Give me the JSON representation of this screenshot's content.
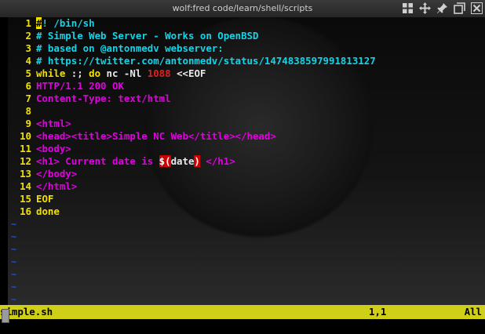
{
  "window": {
    "title": "wolf:fred code/learn/shell/scripts"
  },
  "titlebar_icons": [
    "grid-icon",
    "move-icon",
    "pin-icon",
    "restore-icon",
    "close-icon"
  ],
  "editor": {
    "lines": [
      {
        "num": "1",
        "segments": [
          {
            "t": "#",
            "c": "cursor"
          },
          {
            "t": "! /bin/sh",
            "c": "c-cyan"
          }
        ]
      },
      {
        "num": "2",
        "segments": [
          {
            "t": "# Simple Web Server - Works on OpenBSD",
            "c": "c-cyan"
          }
        ]
      },
      {
        "num": "3",
        "segments": [
          {
            "t": "# based on @antonmedv webserver:",
            "c": "c-cyan"
          }
        ]
      },
      {
        "num": "4",
        "segments": [
          {
            "t": "# https://twitter.com/antonmedv/status/1474838597991813127",
            "c": "c-cyan"
          }
        ]
      },
      {
        "num": "5",
        "segments": [
          {
            "t": "while",
            "c": "c-yellow"
          },
          {
            "t": " :; ",
            "c": "c-white"
          },
          {
            "t": "do",
            "c": "c-yellow"
          },
          {
            "t": " nc -Nl ",
            "c": "c-white"
          },
          {
            "t": "1088",
            "c": "c-red"
          },
          {
            "t": " <<EOF",
            "c": "c-white"
          }
        ]
      },
      {
        "num": "6",
        "segments": [
          {
            "t": "HTTP/1.1 200 OK",
            "c": "c-magenta"
          }
        ]
      },
      {
        "num": "7",
        "segments": [
          {
            "t": "Content-Type: text/html",
            "c": "c-magenta"
          }
        ]
      },
      {
        "num": "8",
        "segments": []
      },
      {
        "num": "9",
        "segments": [
          {
            "t": "<html>",
            "c": "c-magenta"
          }
        ]
      },
      {
        "num": "10",
        "segments": [
          {
            "t": "<head><title>Simple NC Web</title></head>",
            "c": "c-magenta"
          }
        ]
      },
      {
        "num": "11",
        "segments": [
          {
            "t": "<body>",
            "c": "c-magenta"
          }
        ]
      },
      {
        "num": "12",
        "segments": [
          {
            "t": "<h1> Current date is ",
            "c": "c-magenta"
          },
          {
            "t": "$(",
            "c": "red-hl"
          },
          {
            "t": "date",
            "c": "c-white"
          },
          {
            "t": ")",
            "c": "red-hl"
          },
          {
            "t": " </h1>",
            "c": "c-magenta"
          }
        ]
      },
      {
        "num": "13",
        "segments": [
          {
            "t": "</body>",
            "c": "c-magenta"
          }
        ]
      },
      {
        "num": "14",
        "segments": [
          {
            "t": "</html>",
            "c": "c-magenta"
          }
        ]
      },
      {
        "num": "15",
        "segments": [
          {
            "t": "EOF",
            "c": "c-yellow"
          }
        ]
      },
      {
        "num": "16",
        "segments": [
          {
            "t": "done",
            "c": "c-yellow"
          }
        ]
      }
    ],
    "empty_line_marker": "~",
    "empty_line_count": 7
  },
  "status": {
    "filename": "simple.sh",
    "position": "1,1",
    "scroll": "All"
  },
  "colors": {
    "line_number": "#f0e000",
    "comment": "#12d4e8",
    "string": "#e000e0",
    "keyword": "#f0e000",
    "status_bg": "#cfcf18"
  }
}
